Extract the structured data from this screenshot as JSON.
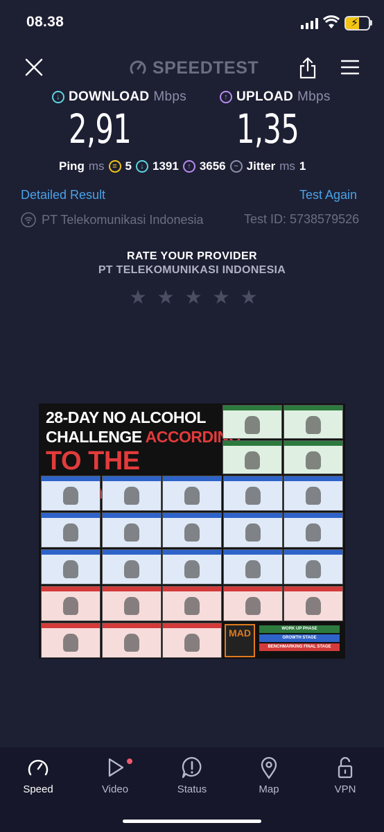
{
  "status_bar": {
    "time": "08.38"
  },
  "header": {
    "logo": "SPEEDTEST"
  },
  "download": {
    "label": "DOWNLOAD",
    "unit": "Mbps",
    "value": "2,91"
  },
  "upload": {
    "label": "UPLOAD",
    "unit": "Mbps",
    "value": "1,35"
  },
  "ping": {
    "label": "Ping",
    "unit": "ms",
    "idle": "5",
    "download": "1391",
    "upload": "3656"
  },
  "jitter": {
    "label": "Jitter",
    "unit": "ms",
    "value": "1"
  },
  "links": {
    "detailed": "Detailed Result",
    "again": "Test Again"
  },
  "isp": {
    "name": "PT Telekomunikasi Indonesia",
    "test_id": "Test ID: 5738579526"
  },
  "rating": {
    "title": "RATE YOUR PROVIDER",
    "provider": "PT TELEKOMUNIKASI INDONESIA",
    "stars": 0,
    "max_stars": 5
  },
  "ad": {
    "line1": "28-DAY NO ALCOHOL",
    "line2a": "CHALLENGE",
    "line2b": "ACCORDING",
    "line3": "TO THE GOALS",
    "brand": "MAD",
    "legend": [
      "WORK UP PHASE",
      "GROWTH STAGE",
      "BENCHMARKING FINAL STAGE"
    ],
    "colors": {
      "green": "#2d7a3e",
      "blue": "#2e63c9",
      "red": "#d33b3b"
    }
  },
  "tabs": [
    {
      "label": "Speed",
      "icon": "speedometer-icon"
    },
    {
      "label": "Video",
      "icon": "play-icon"
    },
    {
      "label": "Status",
      "icon": "alert-bubble-icon"
    },
    {
      "label": "Map",
      "icon": "map-pin-icon"
    },
    {
      "label": "VPN",
      "icon": "lock-icon"
    }
  ],
  "colors": {
    "background": "#1d1f33",
    "download": "#5fd4de",
    "upload": "#b68bf0",
    "link": "#4aa3e8"
  }
}
